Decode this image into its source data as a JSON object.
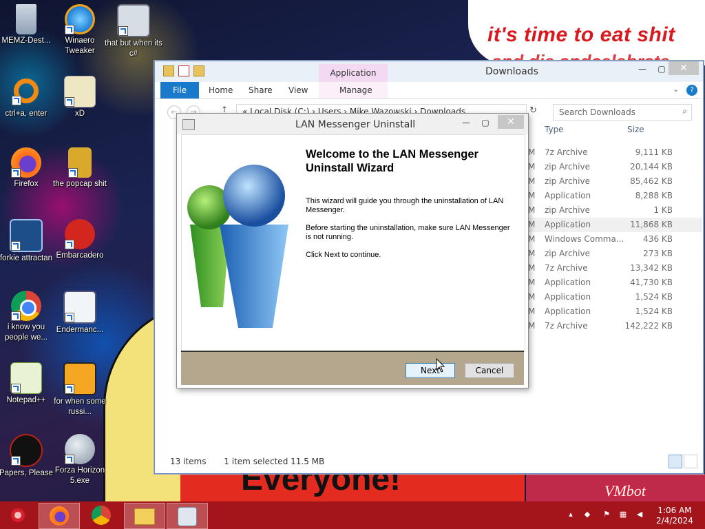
{
  "desktop": {
    "wallpaper_top_text": "it's time to eat shit",
    "wallpaper_top_text2": "and die andcelebrate",
    "wallpaper_bottom_text": "Everyone!",
    "wallpaper_corner_text": "VMbot",
    "icons": [
      {
        "label": "MEMZ-Dest...",
        "icon": "recycle-bin-icon"
      },
      {
        "label": "Winaero Tweaker",
        "icon": "winaero-icon"
      },
      {
        "label": "that but when its c#",
        "icon": "stack-window-icon"
      },
      {
        "label": "ctrl+a, enter",
        "icon": "orange-ring-icon"
      },
      {
        "label": "xD",
        "icon": "hxd-icon"
      },
      {
        "label": "Firefox",
        "icon": "firefox-icon"
      },
      {
        "label": "the popcap shit",
        "icon": "popcap-icon"
      },
      {
        "label": "forkie attractan",
        "icon": "gear-monitor-icon"
      },
      {
        "label": "Embarcadero",
        "icon": "dev-cpp-icon"
      },
      {
        "label": "i know you people we...",
        "icon": "chrome-icon"
      },
      {
        "label": "Endermanc...",
        "icon": "window-app-icon"
      },
      {
        "label": "Notepad++",
        "icon": "notepad-plus-icon"
      },
      {
        "label": "for when some russi...",
        "icon": "de-icon"
      },
      {
        "label": "Papers, Please",
        "icon": "papers-please-icon"
      },
      {
        "label": "Forza Horizon 5.exe",
        "icon": "flash-icon"
      }
    ]
  },
  "explorer": {
    "title": "Downloads",
    "contextual_tab": "Application Tools",
    "ribbon_tabs": [
      "File",
      "Home",
      "Share",
      "View",
      "Manage"
    ],
    "address": "« Local Disk (C:) › Users › Mike Wazowski › Downloads",
    "search_placeholder": "Search Downloads",
    "columns": {
      "type": "Type",
      "size": "Size"
    },
    "rows": [
      {
        "type": "7z Archive",
        "size": "9,111 KB"
      },
      {
        "type": "zip Archive",
        "size": "20,144 KB"
      },
      {
        "type": "zip Archive",
        "size": "85,462 KB"
      },
      {
        "type": "Application",
        "size": "8,288 KB"
      },
      {
        "type": "zip Archive",
        "size": "1 KB"
      },
      {
        "type": "Application",
        "size": "11,868 KB"
      },
      {
        "type": "Windows Comma...",
        "size": "436 KB"
      },
      {
        "type": "zip Archive",
        "size": "273 KB"
      },
      {
        "type": "7z Archive",
        "size": "13,342 KB"
      },
      {
        "type": "Application",
        "size": "41,730 KB"
      },
      {
        "type": "Application",
        "size": "1,524 KB"
      },
      {
        "type": "Application",
        "size": "1,524 KB"
      },
      {
        "type": "7z Archive",
        "size": "142,222 KB"
      }
    ],
    "status": {
      "items": "13 items",
      "selected": "1 item selected  11.5 MB"
    }
  },
  "dialog": {
    "title": "LAN Messenger Uninstall",
    "heading": "Welcome to the LAN Messenger Uninstall Wizard",
    "para1": "This wizard will guide you through the uninstallation of LAN Messenger.",
    "para2": "Before starting the uninstallation, make sure LAN Messenger is not running.",
    "para3": "Click Next to continue.",
    "next_label": "Next",
    "cancel_label": "Cancel"
  },
  "taskbar": {
    "clock_time": "1:06 AM",
    "clock_date": "2/4/2024",
    "color": "#a4151b"
  }
}
